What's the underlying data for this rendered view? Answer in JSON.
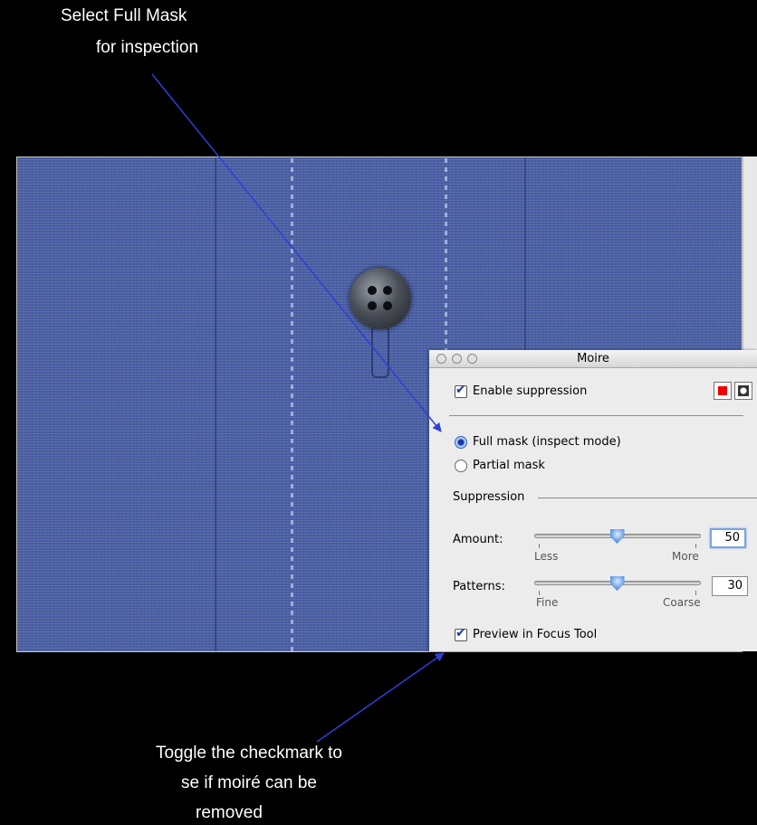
{
  "annotations": {
    "top_line1": "Select Full Mask",
    "top_line2": "for inspection",
    "bottom_line1": "Toggle the checkmark to",
    "bottom_line2": "se if moiré can be",
    "bottom_line3": "removed"
  },
  "panel": {
    "title": "Moire",
    "enable_suppression": {
      "label": "Enable suppression",
      "checked": true
    },
    "mask_options": [
      {
        "label": "Full mask (inspect mode)",
        "selected": true
      },
      {
        "label": "Partial mask",
        "selected": false
      }
    ],
    "group_label": "Suppression",
    "amount": {
      "label": "Amount:",
      "min_label": "Less",
      "max_label": "More",
      "value": "50",
      "level": 0.5
    },
    "patterns": {
      "label": "Patterns:",
      "min_label": "Fine",
      "max_label": "Coarse",
      "value": "30",
      "level": 0.5
    },
    "preview": {
      "label": "Preview in Focus Tool",
      "checked": true
    }
  },
  "colors": {
    "arrow": "#2f3fd6",
    "fabric": "#4a5fa3",
    "panel_bg": "#ececec"
  }
}
